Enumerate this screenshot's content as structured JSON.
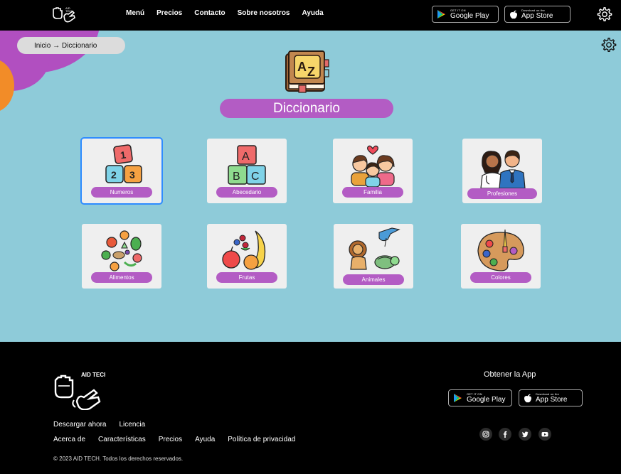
{
  "nav": {
    "links": [
      "Menú",
      "Precios",
      "Contacto",
      "Sobre nosotros",
      "Ayuda"
    ],
    "google_play": {
      "small": "GET IT ON",
      "big": "Google Play"
    },
    "app_store": {
      "small": "Download on the",
      "big": "App Store"
    },
    "logo_icon": "hands-logo-icon",
    "settings_icon": "gear-icon"
  },
  "breadcrumb": "Inicio → Diccionario",
  "page_title": "Diccionario",
  "categories": [
    {
      "label": "Numeros",
      "icon": "number-blocks-icon"
    },
    {
      "label": "Abecedario",
      "icon": "abc-blocks-icon"
    },
    {
      "label": "Familia",
      "icon": "family-icon"
    },
    {
      "label": "Profesiones",
      "icon": "professionals-icon"
    },
    {
      "label": "Alimentos",
      "icon": "vegetables-icon"
    },
    {
      "label": "Frutas",
      "icon": "fruits-icon"
    },
    {
      "label": "Animales",
      "icon": "animals-icon"
    },
    {
      "label": "Colores",
      "icon": "palette-icon"
    }
  ],
  "footer": {
    "brand": "AID TECH",
    "get_app": "Obtener la App",
    "links_row1": [
      "Descargar ahora",
      "Licencia"
    ],
    "links_row2": [
      "Acerca de",
      "Características",
      "Precios",
      "Ayuda",
      "Política de privacidad"
    ],
    "copyright": "© 2023 AID TECH. Todos los derechos reservados.",
    "social_icons": [
      "instagram-icon",
      "facebook-icon",
      "twitter-icon",
      "youtube-icon"
    ]
  },
  "colors": {
    "main_bg": "#8ecbd9",
    "accent_purple": "#b35cc4",
    "selected_outline": "#2f8cff"
  }
}
